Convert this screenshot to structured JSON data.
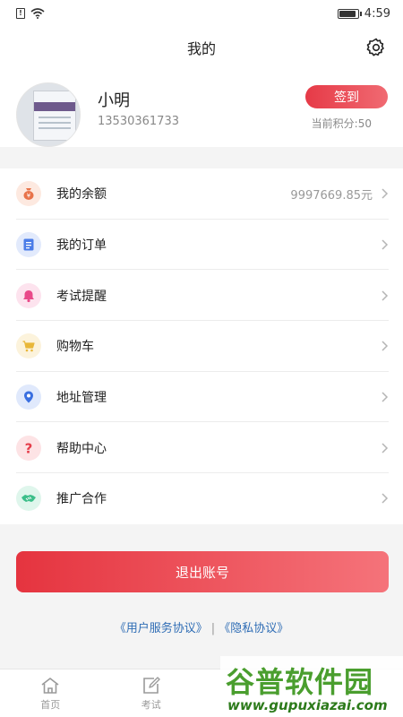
{
  "status_bar": {
    "time": "4:59",
    "sim_label": "!"
  },
  "header": {
    "title": "我的",
    "settings_icon": "gear-icon"
  },
  "profile": {
    "name": "小明",
    "phone": "13530361733",
    "checkin_label": "签到",
    "points_text": "当前积分:50"
  },
  "menu": {
    "items": [
      {
        "label": "我的余额",
        "value": "9997669.85元",
        "icon": "money-bag-icon",
        "color": "#e8734a",
        "bg": "#fde9e0"
      },
      {
        "label": "我的订单",
        "value": "",
        "icon": "order-icon",
        "color": "#4a7ce8",
        "bg": "#e2eafc"
      },
      {
        "label": "考试提醒",
        "value": "",
        "icon": "bell-icon",
        "color": "#e94a8a",
        "bg": "#fde3ee"
      },
      {
        "label": "购物车",
        "value": "",
        "icon": "cart-icon",
        "color": "#e8b73a",
        "bg": "#fcf3dc"
      },
      {
        "label": "地址管理",
        "value": "",
        "icon": "location-icon",
        "color": "#3a6fe0",
        "bg": "#e0e9fc"
      },
      {
        "label": "帮助中心",
        "value": "",
        "icon": "question-icon",
        "color": "#e53e4b",
        "bg": "#fde3e5"
      },
      {
        "label": "推广合作",
        "value": "",
        "icon": "handshake-icon",
        "color": "#3cbf8a",
        "bg": "#dff6ec"
      }
    ]
  },
  "logout": {
    "label": "退出账号"
  },
  "agreements": {
    "user": "《用户服务协议》",
    "separator": "|",
    "privacy": "《隐私协议》"
  },
  "tabbar": {
    "tabs": [
      {
        "label": "首页",
        "icon": "home-icon"
      },
      {
        "label": "考试",
        "icon": "exam-edit-icon"
      },
      {
        "label": "",
        "icon": ""
      },
      {
        "label": "",
        "icon": ""
      }
    ]
  },
  "watermark": {
    "main": "谷普软件园",
    "sub": "www.gupuxiazai.com"
  }
}
